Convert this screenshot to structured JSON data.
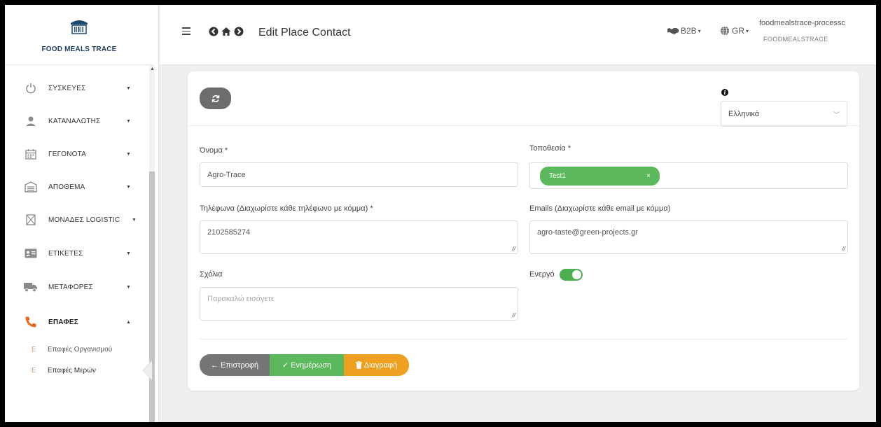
{
  "sidebar": {
    "logo_text": "FOOD MEALS TRACE",
    "items": [
      {
        "label": "ΣΥΣΚΕΥΕΣ",
        "icon": "power-icon"
      },
      {
        "label": "ΚΑΤΑΝΑΛΩΤΗΣ",
        "icon": "user-icon"
      },
      {
        "label": "ΓΕΓΟΝΟΤΑ",
        "icon": "calendar-icon"
      },
      {
        "label": "ΑΠΟΘΕΜΑ",
        "icon": "warehouse-icon"
      },
      {
        "label": "ΜΟΝΑΔΕΣ LOGISTIC",
        "icon": "box-icon"
      },
      {
        "label": "ΕΤΙΚΕΤΕΣ",
        "icon": "id-card-icon"
      },
      {
        "label": "ΜΕΤΑΦΟΡΕΣ",
        "icon": "truck-icon"
      },
      {
        "label": "ΕΠΑΦΕΣ",
        "icon": "phone-icon"
      }
    ],
    "sub_items": [
      {
        "marker": "E",
        "label": "Επαφές Οργανισμού"
      },
      {
        "marker": "E",
        "label": "Επαφές Μερών"
      }
    ]
  },
  "header": {
    "title": "Edit Place Contact",
    "b2b_label": "B2B",
    "lang_label": "GR",
    "user_name": "foodmealstrace-processc",
    "user_org": "FOODMEALSTRACE"
  },
  "form": {
    "language_select": "Ελληνικά",
    "name_label": "Όνομα *",
    "name_value": "Agro-Trace",
    "location_label": "Τοποθεσία *",
    "location_tag": "Test1",
    "location_tag_remove": "×",
    "phones_label": "Τηλέφωνα (Διαχωρίστε κάθε τηλέφωνο με κόμμα) *",
    "phones_value": "2102585274",
    "emails_label": "Emails (Διαχωρίστε κάθε email με κόμμα)",
    "emails_value": "agro-taste@green-projects.gr",
    "comments_label": "Σχόλια",
    "comments_placeholder": "Παρακαλώ εισάγετε",
    "active_label": "Ενεργό",
    "active": true
  },
  "buttons": {
    "back": "← Επιστροφή",
    "update": "✓ Ενημέρωση",
    "delete": "Διαγραφή"
  },
  "colors": {
    "green": "#5cb85c",
    "orange": "#f0a020",
    "gray_button": "#757575",
    "phone_icon": "#e8691c"
  }
}
